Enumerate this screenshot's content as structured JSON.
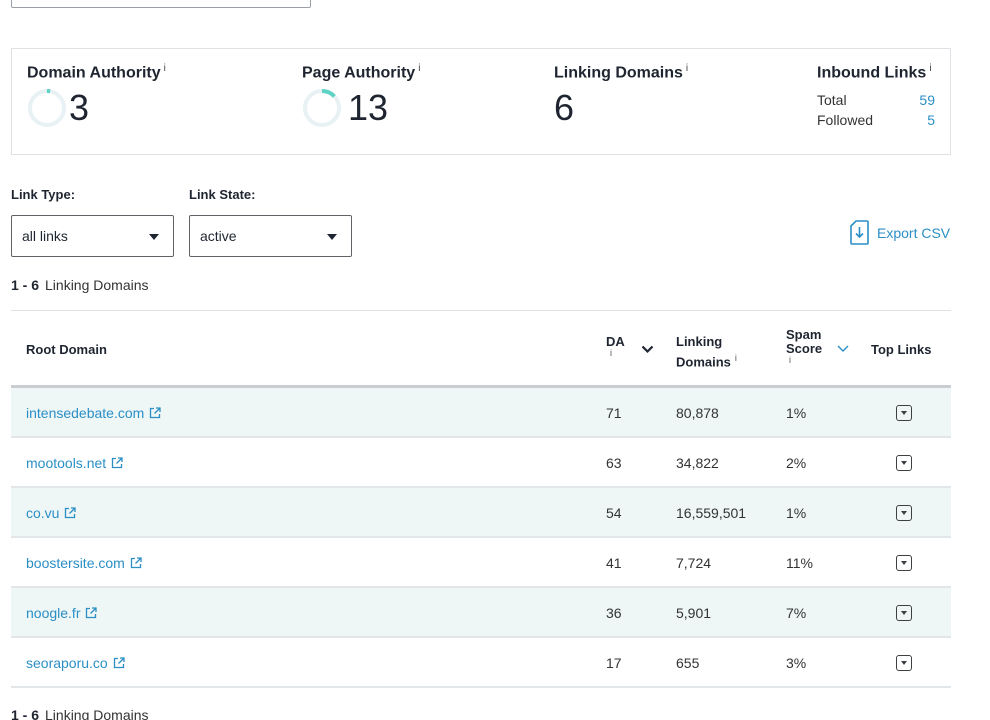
{
  "metrics": {
    "domain_authority": {
      "title": "Domain Authority",
      "info": "i",
      "value": "3",
      "ring_fraction": 0.03
    },
    "page_authority": {
      "title": "Page Authority",
      "info": "i",
      "value": "13",
      "ring_fraction": 0.13
    },
    "linking_domains": {
      "title": "Linking Domains",
      "info": "i",
      "value": "6"
    },
    "inbound_links": {
      "title": "Inbound Links",
      "info": "i",
      "total_label": "Total",
      "total_value": "59",
      "followed_label": "Followed",
      "followed_value": "5"
    }
  },
  "filters": {
    "link_type": {
      "label": "Link Type:",
      "value": "all links"
    },
    "link_state": {
      "label": "Link State:",
      "value": "active"
    }
  },
  "export_label": "Export CSV",
  "range_top": {
    "range": "1 - 6",
    "text": "Linking Domains"
  },
  "range_bottom": {
    "range": "1 - 6",
    "text": "Linking Domains"
  },
  "table": {
    "headers": {
      "root_domain": "Root Domain",
      "da": "DA",
      "da_info": "i",
      "linking_domains_1": "Linking",
      "linking_domains_2": "Domains",
      "linking_info": "i",
      "spam_1": "Spam",
      "spam_2": "Score",
      "spam_info": "i",
      "top_links": "Top Links"
    },
    "rows": [
      {
        "domain": "intensedebate.com",
        "da": "71",
        "linking": "80,878",
        "spam": "1%"
      },
      {
        "domain": "mootools.net",
        "da": "63",
        "linking": "34,822",
        "spam": "2%"
      },
      {
        "domain": "co.vu",
        "da": "54",
        "linking": "16,559,501",
        "spam": "1%"
      },
      {
        "domain": "boostersite.com",
        "da": "41",
        "linking": "7,724",
        "spam": "11%"
      },
      {
        "domain": "noogle.fr",
        "da": "36",
        "linking": "5,901",
        "spam": "7%"
      },
      {
        "domain": "seoraporu.co",
        "da": "17",
        "linking": "655",
        "spam": "3%"
      }
    ]
  },
  "colors": {
    "accent": "#2b8fc6",
    "ring": "#5dd3c4",
    "ring_track": "#e8f1f3",
    "alt_row": "#eef6f6"
  }
}
